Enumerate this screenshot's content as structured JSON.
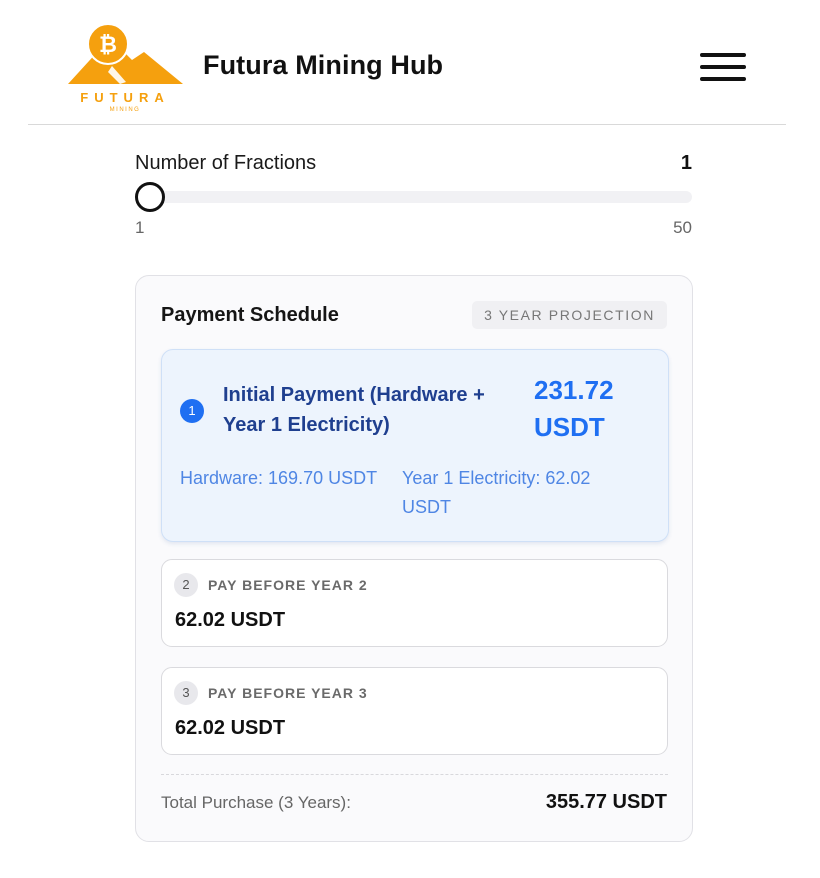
{
  "header": {
    "title": "Futura Mining Hub",
    "logo": {
      "wordmark": "FUTURA",
      "subtext": "MINING",
      "coin_symbol": "₿",
      "color": "#F5A00E"
    },
    "menu_icon": "hamburger-menu-icon"
  },
  "fractions": {
    "label": "Number of Fractions",
    "value": "1",
    "min_label": "1",
    "max_label": "50",
    "level": 0
  },
  "schedule": {
    "title": "Payment Schedule",
    "badge": "3 YEAR PROJECTION",
    "initial": {
      "step": "1",
      "title": "Initial Payment (Hardware + Year 1 Electricity)",
      "amount": "231.72 USDT",
      "hardware": "Hardware: 169.70 USDT",
      "electricity": "Year 1 Electricity: 62.02 USDT"
    },
    "year2": {
      "step": "2",
      "label": "PAY BEFORE YEAR 2",
      "amount": "62.02 USDT"
    },
    "year3": {
      "step": "3",
      "label": "PAY BEFORE YEAR 3",
      "amount": "62.02 USDT"
    },
    "total_label": "Total Purchase (3 Years):",
    "total_value": "355.77 USDT"
  },
  "colors": {
    "accent_blue": "#1F6FF2",
    "brand_orange": "#F5A00E",
    "initial_bg": "#EDF4FD"
  }
}
